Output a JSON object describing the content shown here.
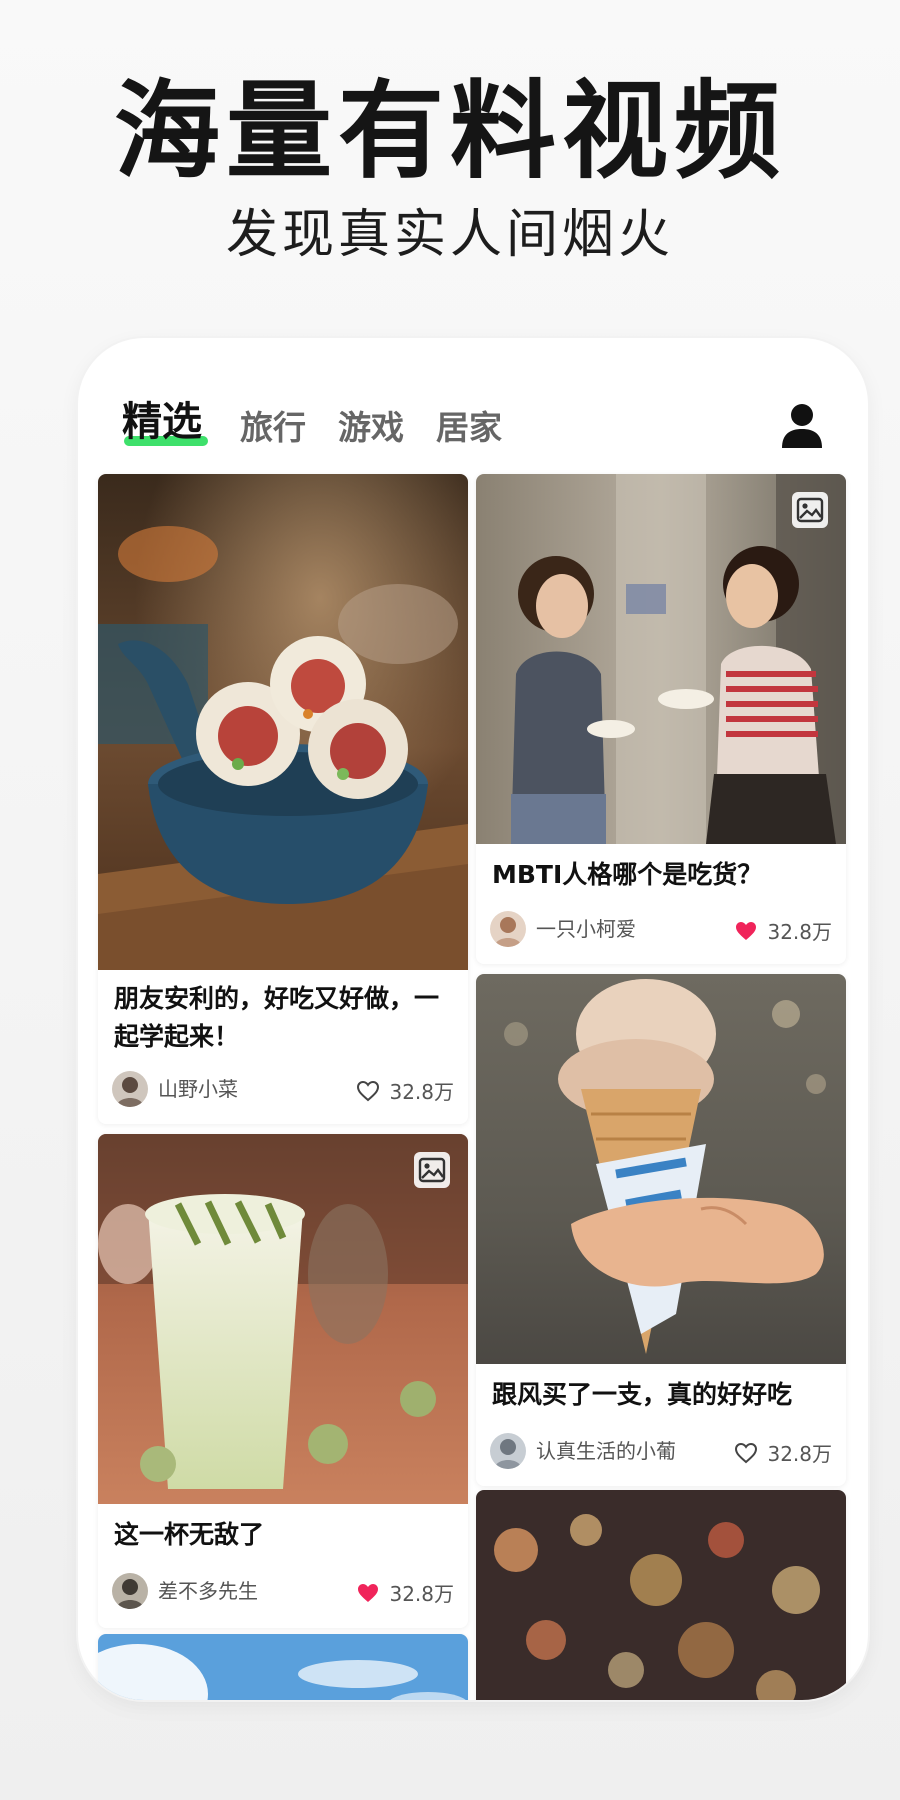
{
  "promo": {
    "headline": "海量有料视频",
    "subheadline": "发现真实人间烟火"
  },
  "tabs": [
    {
      "label": "精选",
      "active": true
    },
    {
      "label": "旅行",
      "active": false
    },
    {
      "label": "游戏",
      "active": false
    },
    {
      "label": "居家",
      "active": false
    }
  ],
  "profile_icon": "person-icon",
  "accent_color": "#3ee06b",
  "like_active_color": "#f0245a",
  "feed": {
    "left": [
      {
        "title": "朋友安利的，好吃又好做，一起学起来！",
        "author": "山野小菜",
        "likes": "32.8万",
        "liked": false,
        "image": "rice-balls-in-bowl"
      },
      {
        "title": "这一杯无敌了",
        "author": "差不多先生",
        "likes": "32.8万",
        "liked": true,
        "image": "matcha-drink",
        "gallery": true
      },
      {
        "image": "blue-sky-clouds"
      }
    ],
    "right": [
      {
        "title": "MBTI人格哪个是吃货？",
        "author": "一只小柯爱",
        "likes": "32.8万",
        "liked": true,
        "image": "two-girls-eating",
        "gallery": true
      },
      {
        "title": "跟风买了一支，真的好好吃",
        "author": "认真生活的小葡",
        "likes": "32.8万",
        "liked": false,
        "image": "ice-cream-cone"
      },
      {
        "image": "city-bokeh-lights"
      }
    ]
  }
}
